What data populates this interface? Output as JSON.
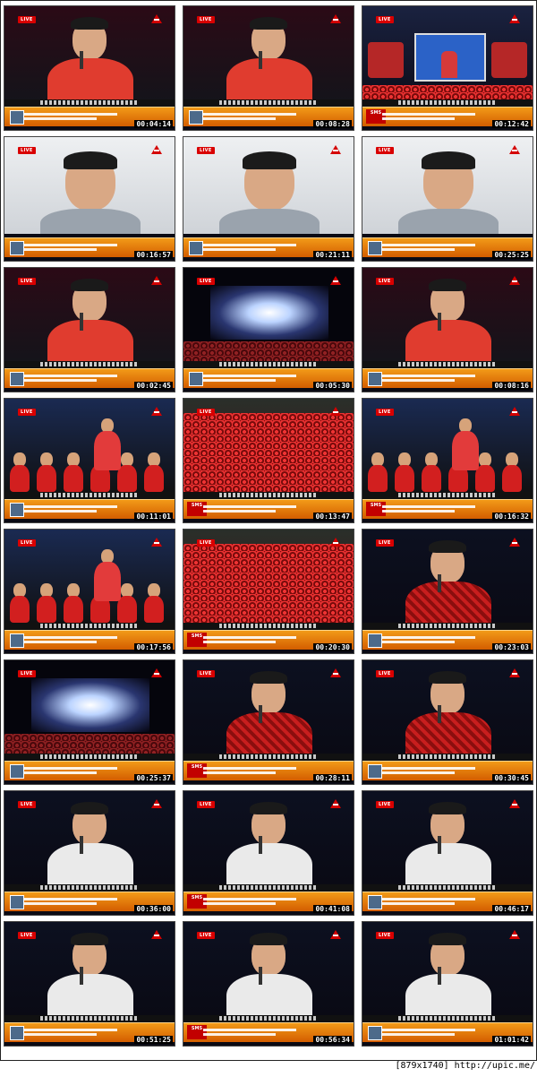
{
  "tiles": [
    {
      "time": "00:04:14",
      "kind": "speaker-red",
      "live": true
    },
    {
      "time": "00:08:28",
      "kind": "speaker-red",
      "live": true
    },
    {
      "time": "00:12:42",
      "kind": "stage-screen",
      "live": true,
      "sms": true
    },
    {
      "time": "00:16:57",
      "kind": "video-call",
      "live": true
    },
    {
      "time": "00:21:11",
      "kind": "video-call",
      "live": true
    },
    {
      "time": "00:25:25",
      "kind": "video-call",
      "live": true
    },
    {
      "time": "00:02:45",
      "kind": "speaker-red",
      "live": true
    },
    {
      "time": "00:05:30",
      "kind": "stage-lights",
      "live": true
    },
    {
      "time": "00:08:16",
      "kind": "speaker-red",
      "live": true
    },
    {
      "time": "00:11:01",
      "kind": "group-stage",
      "live": true
    },
    {
      "time": "00:13:47",
      "kind": "crowd",
      "live": true,
      "sms": true
    },
    {
      "time": "00:16:32",
      "kind": "group-stage",
      "live": true,
      "sms": true
    },
    {
      "time": "00:17:56",
      "kind": "group-stage",
      "live": true
    },
    {
      "time": "00:20:30",
      "kind": "crowd",
      "live": true,
      "sms": true
    },
    {
      "time": "00:23:03",
      "kind": "speaker-plaid",
      "live": true
    },
    {
      "time": "00:25:37",
      "kind": "stage-lights",
      "live": true
    },
    {
      "time": "00:28:11",
      "kind": "speaker-plaid",
      "live": true,
      "sms": true
    },
    {
      "time": "00:30:45",
      "kind": "speaker-plaid",
      "live": true
    },
    {
      "time": "00:36:00",
      "kind": "speaker-white",
      "live": true
    },
    {
      "time": "00:41:08",
      "kind": "speaker-white",
      "live": true,
      "sms": true
    },
    {
      "time": "00:46:17",
      "kind": "speaker-white",
      "live": true
    },
    {
      "time": "00:51:25",
      "kind": "speaker-white",
      "live": true
    },
    {
      "time": "00:56:34",
      "kind": "speaker-white",
      "live": true,
      "sms": true
    },
    {
      "time": "01:01:42",
      "kind": "speaker-white",
      "live": true
    }
  ],
  "labels": {
    "live": "LIVE",
    "sms": "SMS"
  },
  "footer": "[879x1740] http://upic.me/"
}
